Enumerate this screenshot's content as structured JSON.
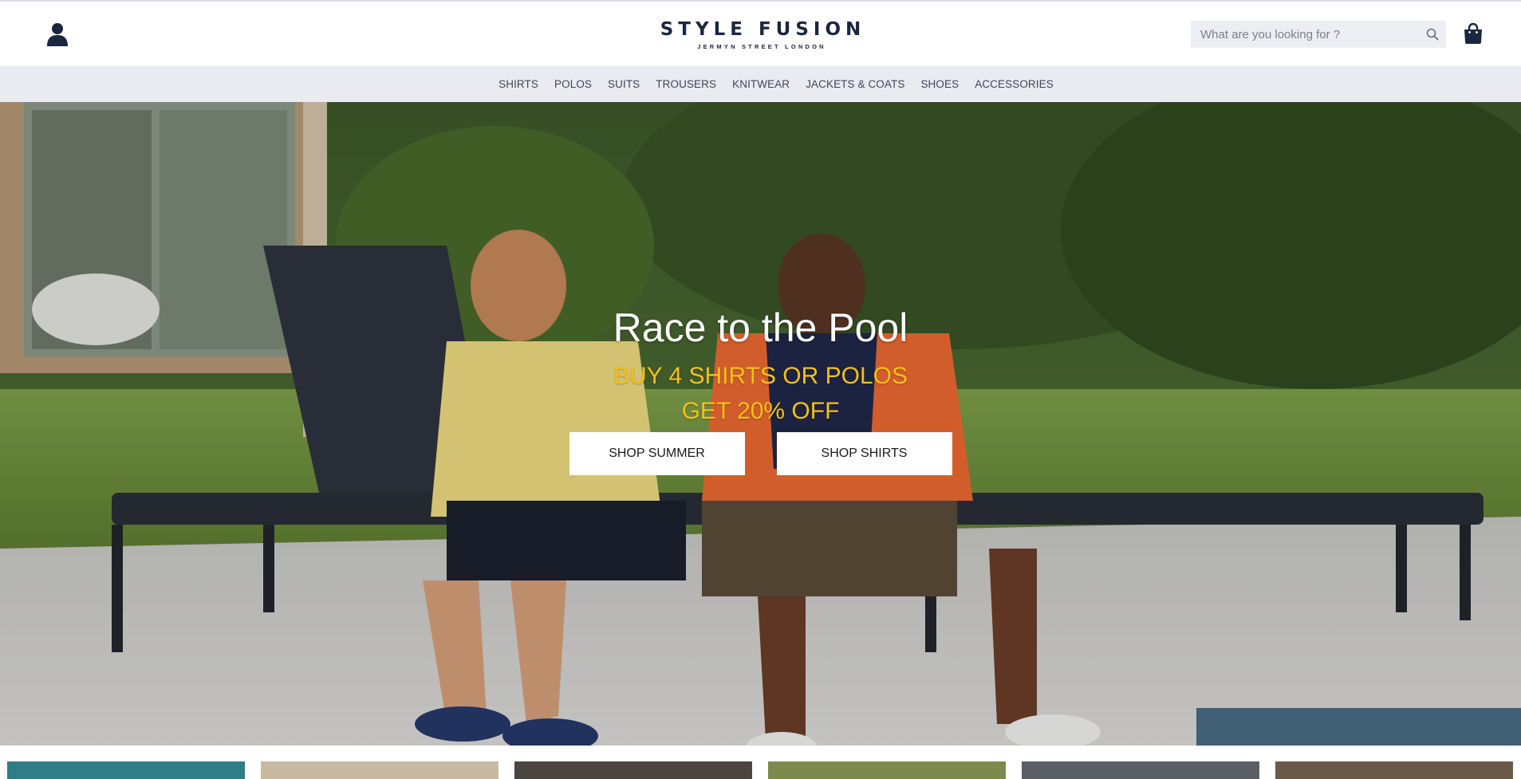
{
  "header": {
    "brand": "STYLE FUSION",
    "tagline": "JERMYN STREET LONDON",
    "account_icon": "user-icon",
    "cart_icon": "shopping-bag-icon",
    "search": {
      "placeholder": "What are you looking for ?",
      "value": "",
      "icon": "search-icon"
    }
  },
  "nav": {
    "items": [
      {
        "label": "SHIRTS"
      },
      {
        "label": "POLOS"
      },
      {
        "label": "SUITS"
      },
      {
        "label": "TROUSERS"
      },
      {
        "label": "KNITWEAR"
      },
      {
        "label": "JACKETS & COATS"
      },
      {
        "label": "SHOES"
      },
      {
        "label": "ACCESSORIES"
      }
    ]
  },
  "hero": {
    "title": "Race to the Pool",
    "subtitle_line1": "BUY 4 SHIRTS OR POLOS",
    "subtitle_line2": "GET 20% OFF",
    "buttons": [
      {
        "label": "SHOP SUMMER"
      },
      {
        "label": "SHOP SHIRTS"
      }
    ]
  },
  "colors": {
    "brand_navy": "#1b2640",
    "nav_bg": "#eaebf0",
    "promo_yellow": "#f5c016",
    "search_bg": "#eceef3"
  }
}
